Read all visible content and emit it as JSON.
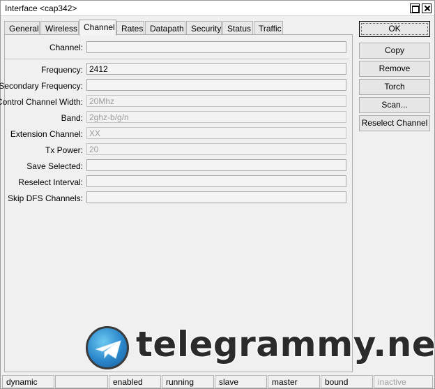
{
  "window": {
    "title": "Interface <cap342>"
  },
  "tabs": [
    {
      "label": "General",
      "active": false
    },
    {
      "label": "Wireless",
      "active": false
    },
    {
      "label": "Channel",
      "active": true
    },
    {
      "label": "Rates",
      "active": false
    },
    {
      "label": "Datapath",
      "active": false
    },
    {
      "label": "Security",
      "active": false
    },
    {
      "label": "Status",
      "active": false
    },
    {
      "label": "Traffic",
      "active": false
    }
  ],
  "form": {
    "channel": {
      "label": "Channel:",
      "value": ""
    },
    "frequency": {
      "label": "Frequency:",
      "value": "2412"
    },
    "secondary_frequency": {
      "label": "Secondary Frequency:",
      "value": ""
    },
    "control_channel_width": {
      "label": "Control Channel Width:",
      "value": "20Mhz"
    },
    "band": {
      "label": "Band:",
      "value": "2ghz-b/g/n"
    },
    "extension_channel": {
      "label": "Extension Channel:",
      "value": "XX"
    },
    "tx_power": {
      "label": "Tx Power:",
      "value": "20"
    },
    "save_selected": {
      "label": "Save Selected:",
      "value": ""
    },
    "reselect_interval": {
      "label": "Reselect Interval:",
      "value": ""
    },
    "skip_dfs_channels": {
      "label": "Skip DFS Channels:",
      "value": ""
    }
  },
  "buttons": {
    "ok": "OK",
    "copy": "Copy",
    "remove": "Remove",
    "torch": "Torch",
    "scan": "Scan...",
    "reselect_channel": "Reselect Channel"
  },
  "watermark": {
    "text": "telegrammy.net"
  },
  "status": [
    "dynamic",
    "",
    "enabled",
    "running",
    "slave",
    "master",
    "bound",
    "inactive"
  ],
  "colors": {
    "disabled_text": "#9c9c9c",
    "panel_bg": "#f0f0f0",
    "watermark_blue": "#2a86c9"
  }
}
